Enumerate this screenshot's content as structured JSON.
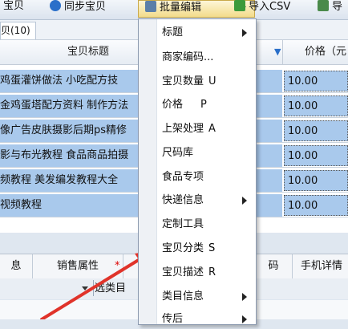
{
  "toolbar": {
    "btn_partial": "宝贝",
    "sync": "同步宝贝",
    "batch_edit": "批量编辑",
    "import_csv": "导入CSV",
    "export_partial": "导"
  },
  "tab_label": "贝(10)",
  "table": {
    "col_title": "宝贝标题",
    "col_price": "价格（元",
    "rows": [
      {
        "title": "鸡蛋灌饼做法 小吃配方技",
        "price": "10.00"
      },
      {
        "title": "金鸡蛋塔配方资料 制作方法",
        "price": "10.00"
      },
      {
        "title": "像广告皮肤摄影后期ps精修",
        "price": "10.00"
      },
      {
        "title": "影与布光教程 食品商品拍摄",
        "price": "10.00"
      },
      {
        "title": "频教程 美发编发教程大全 ",
        "price": "10.00"
      },
      {
        "title": "视频教程",
        "price": "10.00"
      }
    ]
  },
  "bottom_tabs": [
    "息",
    "销售属性",
    "*",
    "码",
    "手机详情"
  ],
  "category_btn": "选类目",
  "menu": [
    {
      "label": "标题",
      "shortcut": "",
      "submenu": true
    },
    {
      "label": "商家编码...",
      "shortcut": "",
      "submenu": false
    },
    {
      "label": "宝贝数量",
      "shortcut": "U",
      "submenu": false
    },
    {
      "label": "价格",
      "shortcut": "P",
      "submenu": false
    },
    {
      "label": "上架处理",
      "shortcut": "A",
      "submenu": false
    },
    {
      "label": "尺码库",
      "shortcut": "",
      "submenu": false
    },
    {
      "label": "食品专项",
      "shortcut": "",
      "submenu": false
    },
    {
      "label": "快递信息",
      "shortcut": "",
      "submenu": true
    },
    {
      "label": "定制工具",
      "shortcut": "",
      "submenu": false
    },
    {
      "label": "宝贝分类",
      "shortcut": "S",
      "submenu": false
    },
    {
      "label": "宝贝描述",
      "shortcut": "R",
      "submenu": false
    },
    {
      "label": "类目信息",
      "shortcut": "",
      "submenu": true
    },
    {
      "label": "传后",
      "shortcut": "",
      "submenu": true
    }
  ],
  "colors": {
    "row_selected": "#a9c9ec",
    "arrow": "#e0332a"
  }
}
